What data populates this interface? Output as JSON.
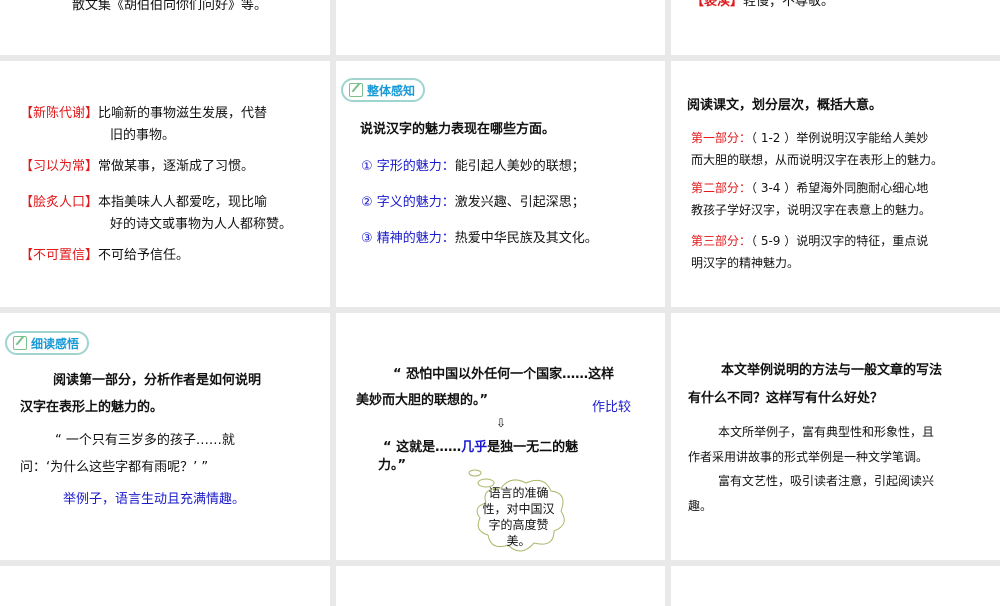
{
  "slides": {
    "s1": {
      "text": "散文集《胡伯伯向你们问好》等。"
    },
    "s3": {
      "term": "【亵渎】",
      "def": "轻慢；不尊敬。"
    },
    "s4": {
      "items": [
        {
          "term": "【新陈代谢】",
          "l1": "比喻新的事物滋生发展，代替",
          "l2": "旧的事物。"
        },
        {
          "term": "【习以为常】",
          "l1": "常做某事，逐渐成了习惯。"
        },
        {
          "term": "【脍炙人口】",
          "l1": "本指美味人人都爱吃，现比喻",
          "l2": "好的诗文或事物为人人都称赞。"
        },
        {
          "term": "【不可置信】",
          "l1": "不可给予信任。"
        }
      ]
    },
    "s5": {
      "badge": "整体感知",
      "question": "说说汉字的魅力表现在哪些方面。",
      "points": [
        {
          "label": "① 字形的魅力：",
          "text": "能引起人美妙的联想；"
        },
        {
          "label": "② 字义的魅力：",
          "text": "激发兴趣、引起深思；"
        },
        {
          "label": "③ 精神的魅力：",
          "text": "热爱中华民族及其文化。"
        }
      ]
    },
    "s6": {
      "title": "阅读课文，划分层次，概括大意。",
      "parts": [
        {
          "label": "第一部分：",
          "l1": "（ 1-2 ）举例说明汉字能给人美妙",
          "l2": "而大胆的联想，从而说明汉字在表形上的魅力。"
        },
        {
          "label": "第二部分：",
          "l1": "（ 3-4 ）希望海外同胞耐心细心地",
          "l2": "教孩子学好汉字，说明汉字在表意上的魅力。"
        },
        {
          "label": "第三部分：",
          "l1": "（ 5-9 ）说明汉字的特征，重点说",
          "l2": "明汉字的精神魅力。"
        }
      ]
    },
    "s7": {
      "badge": "细读感悟",
      "q1": "阅读第一部分，分析作者是如何说明",
      "q2": "汉字在表形上的魅力的。",
      "quote1": "“ 一个只有三岁多的孩子……就",
      "quote2": "问：‘为什么这些字都有雨呢？’ ”",
      "answer": "举例子，语言生动且充满情趣。"
    },
    "s8": {
      "quote1a": "“ 恐怕中国以外任何一个国家……这样",
      "quote1b": "美妙而大胆的联想的。”",
      "compare": "作比较",
      "quote2a": "“ 这就是……",
      "quote2hl": "几乎",
      "quote2b": "是独一无二的魅",
      "quote2c": "力。”",
      "cloud": [
        "语言的准确",
        "性，对中国汉",
        "字的高度赞",
        "美。"
      ]
    },
    "s9": {
      "q1": "本文举例说明的方法与一般文章的写法",
      "q2": "有什么不同？这样写有什么好处？",
      "a1": "本文所举例子，富有典型性和形象性，且",
      "a2": "作者采用讲故事的形式举例是一种文学笔调。",
      "a3": "富有文艺性，吸引读者注意，引起阅读兴",
      "a4": "趣。"
    }
  }
}
